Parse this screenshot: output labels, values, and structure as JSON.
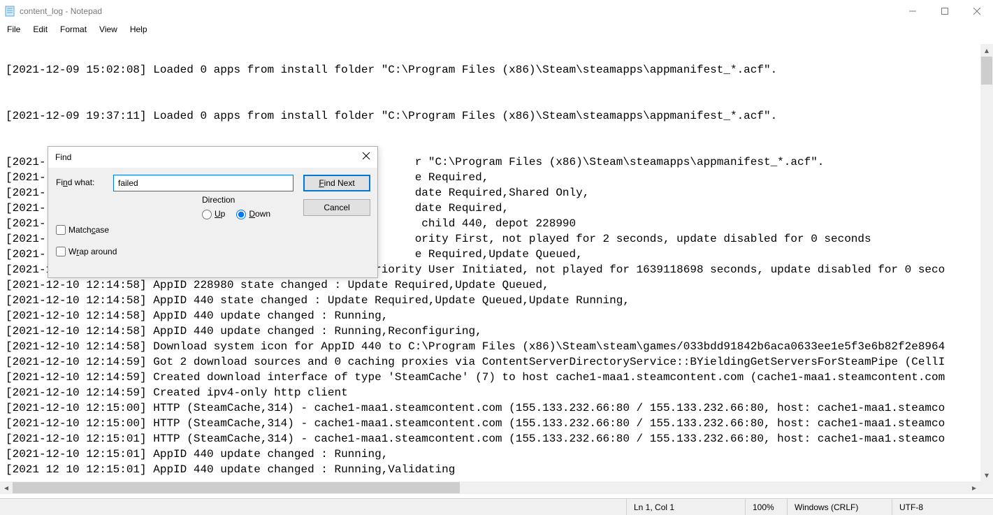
{
  "window": {
    "title": "content_log - Notepad",
    "minimize": "–",
    "maximize": "☐",
    "close": "✕"
  },
  "menu": {
    "file": "File",
    "edit": "Edit",
    "format": "Format",
    "view": "View",
    "help": "Help"
  },
  "content": "\n[2021-12-09 15:02:08] Loaded 0 apps from install folder \"C:\\Program Files (x86)\\Steam\\steamapps\\appmanifest_*.acf\".\n\n\n[2021-12-09 19:37:11] Loaded 0 apps from install folder \"C:\\Program Files (x86)\\Steam\\steamapps\\appmanifest_*.acf\".\n\n\n[2021-                                                       r \"C:\\Program Files (x86)\\Steam\\steamapps\\appmanifest_*.acf\".\n[2021-                                                       e Required,\n[2021-                                                       date Required,Shared Only,\n[2021-                                                       date Required,\n[2021-                                                        child 440, depot 228990\n[2021-                                                       ority First, not played for 2 seconds, update disabled for 0 seconds\n[2021-                                                       e Required,Update Queued,\n[2021-12-10 12:14:58] AppID 228980 scheduler update : Priority User Initiated, not played for 1639118698 seconds, update disabled for 0 seco\n[2021-12-10 12:14:58] AppID 228980 state changed : Update Required,Update Queued,\n[2021-12-10 12:14:58] AppID 440 state changed : Update Required,Update Queued,Update Running,\n[2021-12-10 12:14:58] AppID 440 update changed : Running,\n[2021-12-10 12:14:58] AppID 440 update changed : Running,Reconfiguring,\n[2021-12-10 12:14:58] Download system icon for AppID 440 to C:\\Program Files (x86)\\Steam\\steam\\games/033bdd91842b6aca0633ee1e5f3e6b82f2e8964\n[2021-12-10 12:14:59] Got 2 download sources and 0 caching proxies via ContentServerDirectoryService::BYieldingGetServersForSteamPipe (CellI\n[2021-12-10 12:14:59] Created download interface of type 'SteamCache' (7) to host cache1-maa1.steamcontent.com (cache1-maa1.steamcontent.com\n[2021-12-10 12:14:59] Created ipv4-only http client\n[2021-12-10 12:15:00] HTTP (SteamCache,314) - cache1-maa1.steamcontent.com (155.133.232.66:80 / 155.133.232.66:80, host: cache1-maa1.steamco\n[2021-12-10 12:15:00] HTTP (SteamCache,314) - cache1-maa1.steamcontent.com (155.133.232.66:80 / 155.133.232.66:80, host: cache1-maa1.steamco\n[2021-12-10 12:15:01] HTTP (SteamCache,314) - cache1-maa1.steamcontent.com (155.133.232.66:80 / 155.133.232.66:80, host: cache1-maa1.steamco\n[2021-12-10 12:15:01] AppID 440 update changed : Running,\n[2021 12 10 12:15:01] AppID 440 update changed : Running,Validating",
  "find": {
    "title": "Find",
    "findwhat_label": "Find what:",
    "findwhat_value": "failed",
    "findnext": "Find Next",
    "cancel": "Cancel",
    "direction": "Direction",
    "up": "Up",
    "down": "Down",
    "matchcase": "Match case",
    "wraparound": "Wrap around",
    "close": "✕"
  },
  "status": {
    "position": "Ln 1, Col 1",
    "zoom": "100%",
    "lineending": "Windows (CRLF)",
    "encoding": "UTF-8"
  }
}
